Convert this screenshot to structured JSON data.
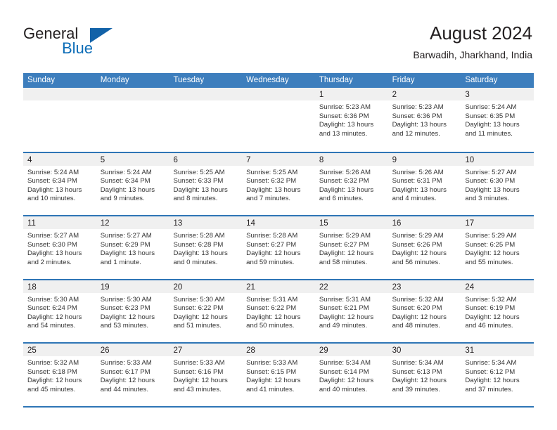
{
  "brand": {
    "name_part1": "General",
    "name_part2": "Blue",
    "triangle_color": "#1262a8",
    "blue_color": "#0b6cb7"
  },
  "header": {
    "title": "August 2024",
    "subtitle": "Barwadih, Jharkhand, India"
  },
  "theme": {
    "header_blue": "#3d7ebd",
    "row_divider_blue": "#2e75b6",
    "day_band_gray": "#f0f0f0",
    "text_color": "#231f20"
  },
  "weekdays": [
    "Sunday",
    "Monday",
    "Tuesday",
    "Wednesday",
    "Thursday",
    "Friday",
    "Saturday"
  ],
  "weeks": [
    [
      {
        "day": "",
        "lines": []
      },
      {
        "day": "",
        "lines": []
      },
      {
        "day": "",
        "lines": []
      },
      {
        "day": "",
        "lines": []
      },
      {
        "day": "1",
        "lines": [
          "Sunrise: 5:23 AM",
          "Sunset: 6:36 PM",
          "Daylight: 13 hours",
          "and 13 minutes."
        ]
      },
      {
        "day": "2",
        "lines": [
          "Sunrise: 5:23 AM",
          "Sunset: 6:36 PM",
          "Daylight: 13 hours",
          "and 12 minutes."
        ]
      },
      {
        "day": "3",
        "lines": [
          "Sunrise: 5:24 AM",
          "Sunset: 6:35 PM",
          "Daylight: 13 hours",
          "and 11 minutes."
        ]
      }
    ],
    [
      {
        "day": "4",
        "lines": [
          "Sunrise: 5:24 AM",
          "Sunset: 6:34 PM",
          "Daylight: 13 hours",
          "and 10 minutes."
        ]
      },
      {
        "day": "5",
        "lines": [
          "Sunrise: 5:24 AM",
          "Sunset: 6:34 PM",
          "Daylight: 13 hours",
          "and 9 minutes."
        ]
      },
      {
        "day": "6",
        "lines": [
          "Sunrise: 5:25 AM",
          "Sunset: 6:33 PM",
          "Daylight: 13 hours",
          "and 8 minutes."
        ]
      },
      {
        "day": "7",
        "lines": [
          "Sunrise: 5:25 AM",
          "Sunset: 6:32 PM",
          "Daylight: 13 hours",
          "and 7 minutes."
        ]
      },
      {
        "day": "8",
        "lines": [
          "Sunrise: 5:26 AM",
          "Sunset: 6:32 PM",
          "Daylight: 13 hours",
          "and 6 minutes."
        ]
      },
      {
        "day": "9",
        "lines": [
          "Sunrise: 5:26 AM",
          "Sunset: 6:31 PM",
          "Daylight: 13 hours",
          "and 4 minutes."
        ]
      },
      {
        "day": "10",
        "lines": [
          "Sunrise: 5:27 AM",
          "Sunset: 6:30 PM",
          "Daylight: 13 hours",
          "and 3 minutes."
        ]
      }
    ],
    [
      {
        "day": "11",
        "lines": [
          "Sunrise: 5:27 AM",
          "Sunset: 6:30 PM",
          "Daylight: 13 hours",
          "and 2 minutes."
        ]
      },
      {
        "day": "12",
        "lines": [
          "Sunrise: 5:27 AM",
          "Sunset: 6:29 PM",
          "Daylight: 13 hours",
          "and 1 minute."
        ]
      },
      {
        "day": "13",
        "lines": [
          "Sunrise: 5:28 AM",
          "Sunset: 6:28 PM",
          "Daylight: 13 hours",
          "and 0 minutes."
        ]
      },
      {
        "day": "14",
        "lines": [
          "Sunrise: 5:28 AM",
          "Sunset: 6:27 PM",
          "Daylight: 12 hours",
          "and 59 minutes."
        ]
      },
      {
        "day": "15",
        "lines": [
          "Sunrise: 5:29 AM",
          "Sunset: 6:27 PM",
          "Daylight: 12 hours",
          "and 58 minutes."
        ]
      },
      {
        "day": "16",
        "lines": [
          "Sunrise: 5:29 AM",
          "Sunset: 6:26 PM",
          "Daylight: 12 hours",
          "and 56 minutes."
        ]
      },
      {
        "day": "17",
        "lines": [
          "Sunrise: 5:29 AM",
          "Sunset: 6:25 PM",
          "Daylight: 12 hours",
          "and 55 minutes."
        ]
      }
    ],
    [
      {
        "day": "18",
        "lines": [
          "Sunrise: 5:30 AM",
          "Sunset: 6:24 PM",
          "Daylight: 12 hours",
          "and 54 minutes."
        ]
      },
      {
        "day": "19",
        "lines": [
          "Sunrise: 5:30 AM",
          "Sunset: 6:23 PM",
          "Daylight: 12 hours",
          "and 53 minutes."
        ]
      },
      {
        "day": "20",
        "lines": [
          "Sunrise: 5:30 AM",
          "Sunset: 6:22 PM",
          "Daylight: 12 hours",
          "and 51 minutes."
        ]
      },
      {
        "day": "21",
        "lines": [
          "Sunrise: 5:31 AM",
          "Sunset: 6:22 PM",
          "Daylight: 12 hours",
          "and 50 minutes."
        ]
      },
      {
        "day": "22",
        "lines": [
          "Sunrise: 5:31 AM",
          "Sunset: 6:21 PM",
          "Daylight: 12 hours",
          "and 49 minutes."
        ]
      },
      {
        "day": "23",
        "lines": [
          "Sunrise: 5:32 AM",
          "Sunset: 6:20 PM",
          "Daylight: 12 hours",
          "and 48 minutes."
        ]
      },
      {
        "day": "24",
        "lines": [
          "Sunrise: 5:32 AM",
          "Sunset: 6:19 PM",
          "Daylight: 12 hours",
          "and 46 minutes."
        ]
      }
    ],
    [
      {
        "day": "25",
        "lines": [
          "Sunrise: 5:32 AM",
          "Sunset: 6:18 PM",
          "Daylight: 12 hours",
          "and 45 minutes."
        ]
      },
      {
        "day": "26",
        "lines": [
          "Sunrise: 5:33 AM",
          "Sunset: 6:17 PM",
          "Daylight: 12 hours",
          "and 44 minutes."
        ]
      },
      {
        "day": "27",
        "lines": [
          "Sunrise: 5:33 AM",
          "Sunset: 6:16 PM",
          "Daylight: 12 hours",
          "and 43 minutes."
        ]
      },
      {
        "day": "28",
        "lines": [
          "Sunrise: 5:33 AM",
          "Sunset: 6:15 PM",
          "Daylight: 12 hours",
          "and 41 minutes."
        ]
      },
      {
        "day": "29",
        "lines": [
          "Sunrise: 5:34 AM",
          "Sunset: 6:14 PM",
          "Daylight: 12 hours",
          "and 40 minutes."
        ]
      },
      {
        "day": "30",
        "lines": [
          "Sunrise: 5:34 AM",
          "Sunset: 6:13 PM",
          "Daylight: 12 hours",
          "and 39 minutes."
        ]
      },
      {
        "day": "31",
        "lines": [
          "Sunrise: 5:34 AM",
          "Sunset: 6:12 PM",
          "Daylight: 12 hours",
          "and 37 minutes."
        ]
      }
    ]
  ]
}
